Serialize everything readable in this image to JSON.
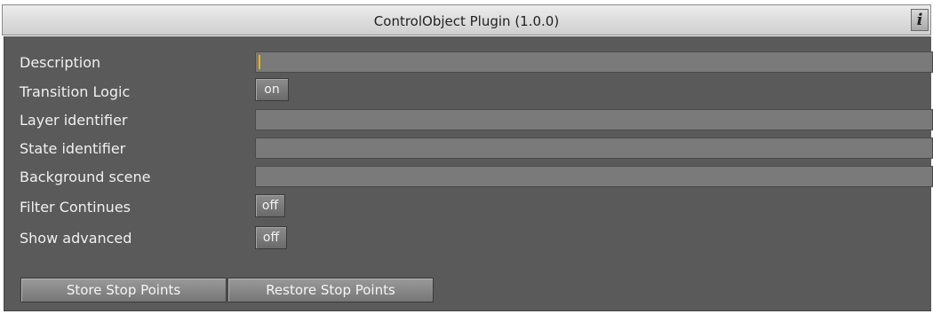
{
  "window": {
    "title": "ControlObject Plugin (1.0.0)",
    "info_glyph": "i"
  },
  "fields": {
    "description": {
      "label": "Description",
      "value": ""
    },
    "transition_logic": {
      "label": "Transition Logic",
      "state": "on"
    },
    "layer_identifier": {
      "label": "Layer identifier",
      "value": ""
    },
    "state_identifier": {
      "label": "State identifier",
      "value": ""
    },
    "background_scene": {
      "label": "Background scene",
      "value": ""
    },
    "filter_continues": {
      "label": "Filter Continues",
      "state": "off"
    },
    "show_advanced": {
      "label": "Show advanced",
      "state": "off"
    }
  },
  "actions": {
    "store_stop_points": "Store Stop Points",
    "restore_stop_points": "Restore Stop Points"
  },
  "colors": {
    "panel_background": "#5a5a5a",
    "field_background": "#7a7a7a",
    "caret": "#e8b400",
    "titlebar": "#dcdcdc"
  }
}
